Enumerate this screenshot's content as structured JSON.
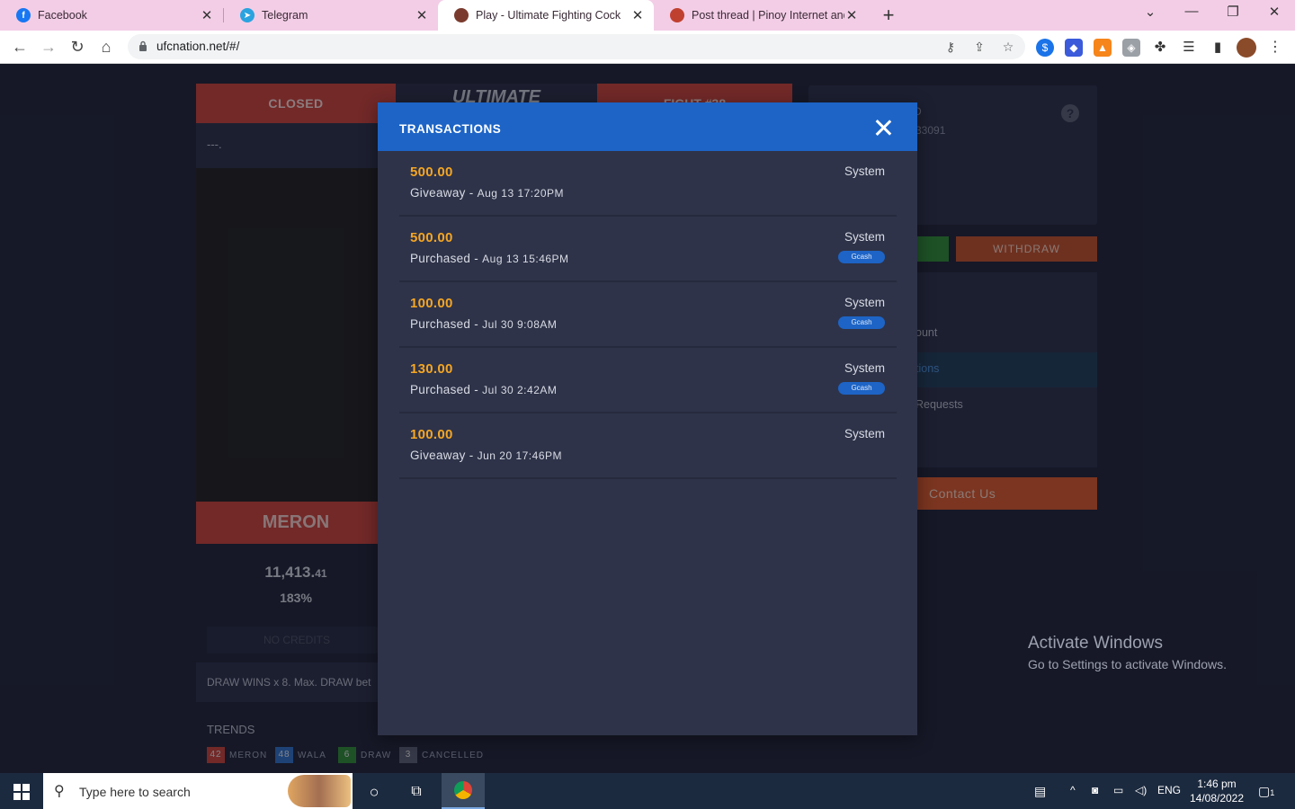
{
  "browser": {
    "tabs": [
      {
        "title": "Facebook",
        "icon": "facebook-icon",
        "color": "#1877f2",
        "active": false
      },
      {
        "title": "Telegram",
        "icon": "telegram-icon",
        "color": "#2aa3df",
        "active": false
      },
      {
        "title": "Play - Ultimate Fighting Cock",
        "icon": "rooster-icon",
        "color": "#7a3b2e",
        "active": true
      },
      {
        "title": "Post thread | Pinoy Internet and T",
        "icon": "forum-icon",
        "color": "#c04030",
        "active": false
      }
    ],
    "url": "ufcnation.net/#/"
  },
  "page": {
    "closed_label": "CLOSED",
    "title_label": "ULTIMATE",
    "fight_label": "FIGHT #38",
    "status_text": "---.",
    "meron_label": "MERON",
    "meron_amount_main": "11,413.",
    "meron_amount_dec": "41",
    "meron_percent": "183%",
    "place_bet_label": "NO CREDITS",
    "draw_note": "DRAW WINS x 8. Max. DRAW bet",
    "trends_label": "TRENDS",
    "trends": [
      {
        "count": "42",
        "label": "MERON",
        "color": "#c6423a"
      },
      {
        "count": "48",
        "label": "WALA",
        "color": "#2f6fc6"
      },
      {
        "count": "6",
        "label": "DRAW",
        "color": "#2f8a36"
      },
      {
        "count": "3",
        "label": "CANCELLED",
        "color": "#5a5f73"
      }
    ],
    "account_name": "D",
    "account_id": "33091",
    "withdraw_label": "WITHDRAW",
    "menu": {
      "account": "ount",
      "transactions": "tions",
      "requests": "Requests"
    },
    "contact_label": "Contact Us"
  },
  "modal": {
    "title": "TRANSACTIONS",
    "transactions": [
      {
        "amount": "500.00",
        "type": "Giveaway",
        "date": "Aug 13 17:20PM",
        "source": "System",
        "badge": ""
      },
      {
        "amount": "500.00",
        "type": "Purchased",
        "date": "Aug 13 15:46PM",
        "source": "System",
        "badge": "Gcash"
      },
      {
        "amount": "100.00",
        "type": "Purchased",
        "date": "Jul 30 9:08AM",
        "source": "System",
        "badge": "Gcash"
      },
      {
        "amount": "130.00",
        "type": "Purchased",
        "date": "Jul 30 2:42AM",
        "source": "System",
        "badge": "Gcash"
      },
      {
        "amount": "100.00",
        "type": "Giveaway",
        "date": "Jun 20 17:46PM",
        "source": "System",
        "badge": ""
      }
    ]
  },
  "watermark": {
    "line1": "Activate Windows",
    "line2": "Go to Settings to activate Windows."
  },
  "taskbar": {
    "search_placeholder": "Type here to search",
    "language": "ENG",
    "time": "1:46 pm",
    "date": "14/08/2022",
    "notification_count": "1"
  }
}
